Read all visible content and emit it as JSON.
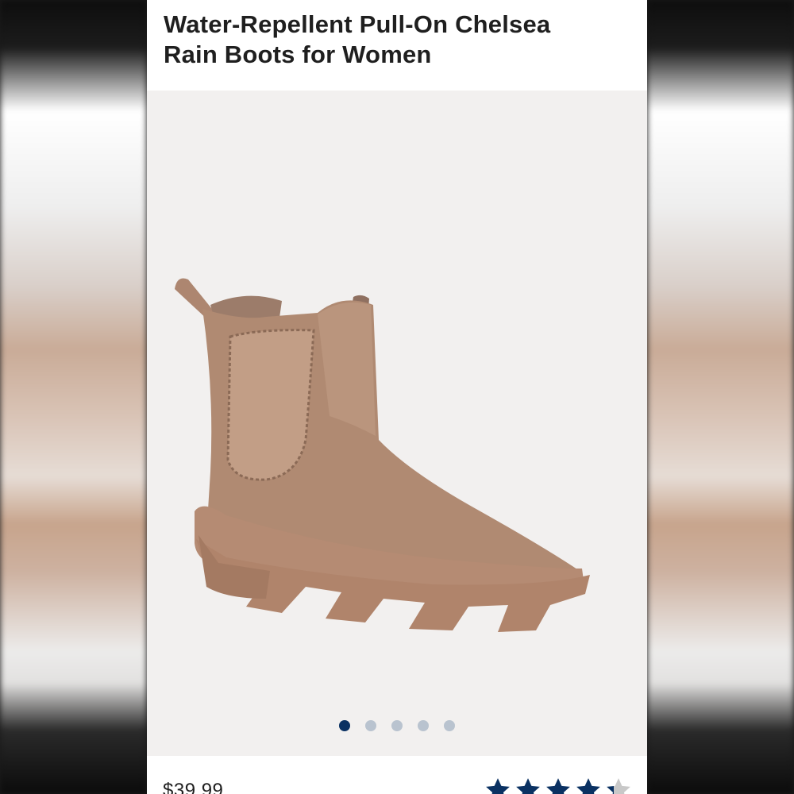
{
  "product": {
    "title_line1": "Water-Repellent Pull-On Chelsea",
    "title_line2": "Rain Boots for Women",
    "price": "$39.99",
    "image_icon": "boot-photo",
    "carousel": {
      "total": 5,
      "active_index": 0
    },
    "rating": {
      "value": 4,
      "max": 5
    }
  },
  "colors": {
    "accent_navy": "#0a3162",
    "inactive_dot": "#b9c3cf",
    "boot_tan": "#b08a72"
  }
}
